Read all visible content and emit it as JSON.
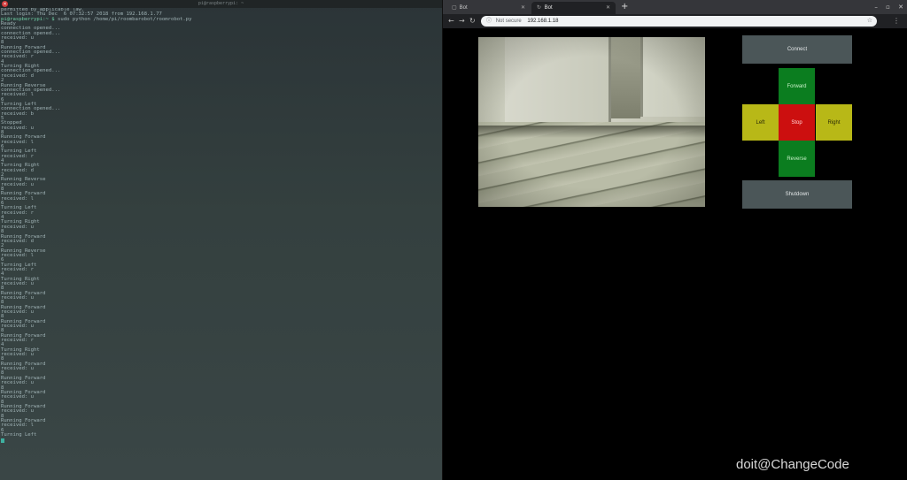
{
  "terminal": {
    "title": "pi@raspberrypi: ~",
    "lines": [
      {
        "text": "permitted by applicable law."
      },
      {
        "text": "Last login: Thu Dec  6 07:32:57 2018 from 192.168.1.77"
      },
      {
        "user": "pi@raspberrypi:~ $",
        "text": " sudo python /home/pi/roombarobot/roomrobot.py"
      },
      {
        "text": "Ready"
      },
      {
        "text": "connection opened..."
      },
      {
        "text": "connection opened..."
      },
      {
        "text": "received: u"
      },
      {
        "text": "8"
      },
      {
        "text": "Running Forward"
      },
      {
        "text": "connection opened..."
      },
      {
        "text": "received: r"
      },
      {
        "text": "4"
      },
      {
        "text": "Turning Right"
      },
      {
        "text": "connection opened..."
      },
      {
        "text": "received: d"
      },
      {
        "text": "2"
      },
      {
        "text": "Running Reverse"
      },
      {
        "text": "connection opened..."
      },
      {
        "text": "received: l"
      },
      {
        "text": "6"
      },
      {
        "text": "Turning Left"
      },
      {
        "text": "connection opened..."
      },
      {
        "text": "received: b"
      },
      {
        "text": "5"
      },
      {
        "text": "Stopped"
      },
      {
        "text": "received: u"
      },
      {
        "text": "8"
      },
      {
        "text": "Running Forward"
      },
      {
        "text": "received: l"
      },
      {
        "text": "6"
      },
      {
        "text": "Turning Left"
      },
      {
        "text": "received: r"
      },
      {
        "text": "4"
      },
      {
        "text": "Turning Right"
      },
      {
        "text": "received: d"
      },
      {
        "text": "2"
      },
      {
        "text": "Running Reverse"
      },
      {
        "text": "received: u"
      },
      {
        "text": "8"
      },
      {
        "text": "Running Forward"
      },
      {
        "text": "received: l"
      },
      {
        "text": "6"
      },
      {
        "text": "Turning Left"
      },
      {
        "text": "received: r"
      },
      {
        "text": "4"
      },
      {
        "text": "Turning Right"
      },
      {
        "text": "received: u"
      },
      {
        "text": "8"
      },
      {
        "text": "Running Forward"
      },
      {
        "text": "received: d"
      },
      {
        "text": "2"
      },
      {
        "text": "Running Reverse"
      },
      {
        "text": "received: l"
      },
      {
        "text": "6"
      },
      {
        "text": "Turning Left"
      },
      {
        "text": "received: r"
      },
      {
        "text": "4"
      },
      {
        "text": "Turning Right"
      },
      {
        "text": "received: u"
      },
      {
        "text": "8"
      },
      {
        "text": "Running Forward"
      },
      {
        "text": "received: u"
      },
      {
        "text": "8"
      },
      {
        "text": "Running Forward"
      },
      {
        "text": "received: u"
      },
      {
        "text": "8"
      },
      {
        "text": "Running Forward"
      },
      {
        "text": "received: u"
      },
      {
        "text": "8"
      },
      {
        "text": "Running Forward"
      },
      {
        "text": "received: r"
      },
      {
        "text": "4"
      },
      {
        "text": "Turning Right"
      },
      {
        "text": "received: u"
      },
      {
        "text": "8"
      },
      {
        "text": "Running Forward"
      },
      {
        "text": "received: u"
      },
      {
        "text": "8"
      },
      {
        "text": "Running Forward"
      },
      {
        "text": "received: u"
      },
      {
        "text": "8"
      },
      {
        "text": "Running Forward"
      },
      {
        "text": "received: u"
      },
      {
        "text": "8"
      },
      {
        "text": "Running Forward"
      },
      {
        "text": "received: u"
      },
      {
        "text": "8"
      },
      {
        "text": "Running Forward"
      },
      {
        "text": "received: l"
      },
      {
        "text": "6"
      },
      {
        "text": "Turning Left"
      }
    ]
  },
  "browser": {
    "tabs": [
      {
        "label": "Bot",
        "icon": "page-icon",
        "active": false
      },
      {
        "label": "Bot",
        "icon": "reload-icon",
        "active": true
      }
    ],
    "omnibox": {
      "security_label": "Not secure",
      "url": "192.168.1.18"
    }
  },
  "controls": {
    "connect": "Connect",
    "forward": "Forward",
    "left": "Left",
    "stop": "Stop",
    "right": "Right",
    "reverse": "Reverse",
    "shutdown": "Shutdown"
  },
  "colors": {
    "gray": "#4b5658",
    "green": "#0b7d1f",
    "yellow": "#b8b817",
    "red": "#cc0f0f"
  },
  "watermark": "doit@ChangeCode"
}
